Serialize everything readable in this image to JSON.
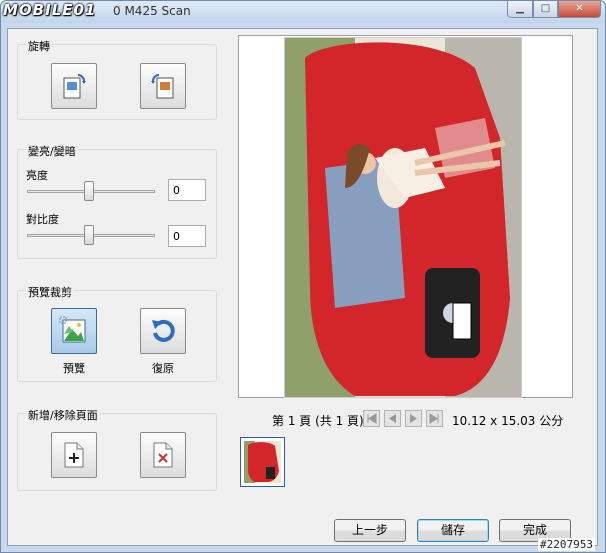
{
  "window": {
    "logo": "MOBILE01",
    "title": "0 M425 Scan",
    "controls": [
      "minimize",
      "maximize",
      "close"
    ]
  },
  "rotate": {
    "label": "旋轉"
  },
  "brightness_contrast": {
    "label": "變亮/變暗",
    "brightness_label": "亮度",
    "brightness_value": "0",
    "contrast_label": "對比度",
    "contrast_value": "0"
  },
  "crop": {
    "label": "預覽裁剪",
    "preview_label": "預覽",
    "restore_label": "復原"
  },
  "pages": {
    "label": "新增/移除頁面"
  },
  "page_info": "第 1 頁 (共 1 頁)",
  "page_size": "10.12 x 15.03 公分",
  "buttons": {
    "back": "上一步",
    "save": "儲存",
    "finish": "完成"
  },
  "watermark": "#2207953",
  "colors": {
    "accent": "#3c6b9a",
    "car_red": "#d3262a"
  }
}
